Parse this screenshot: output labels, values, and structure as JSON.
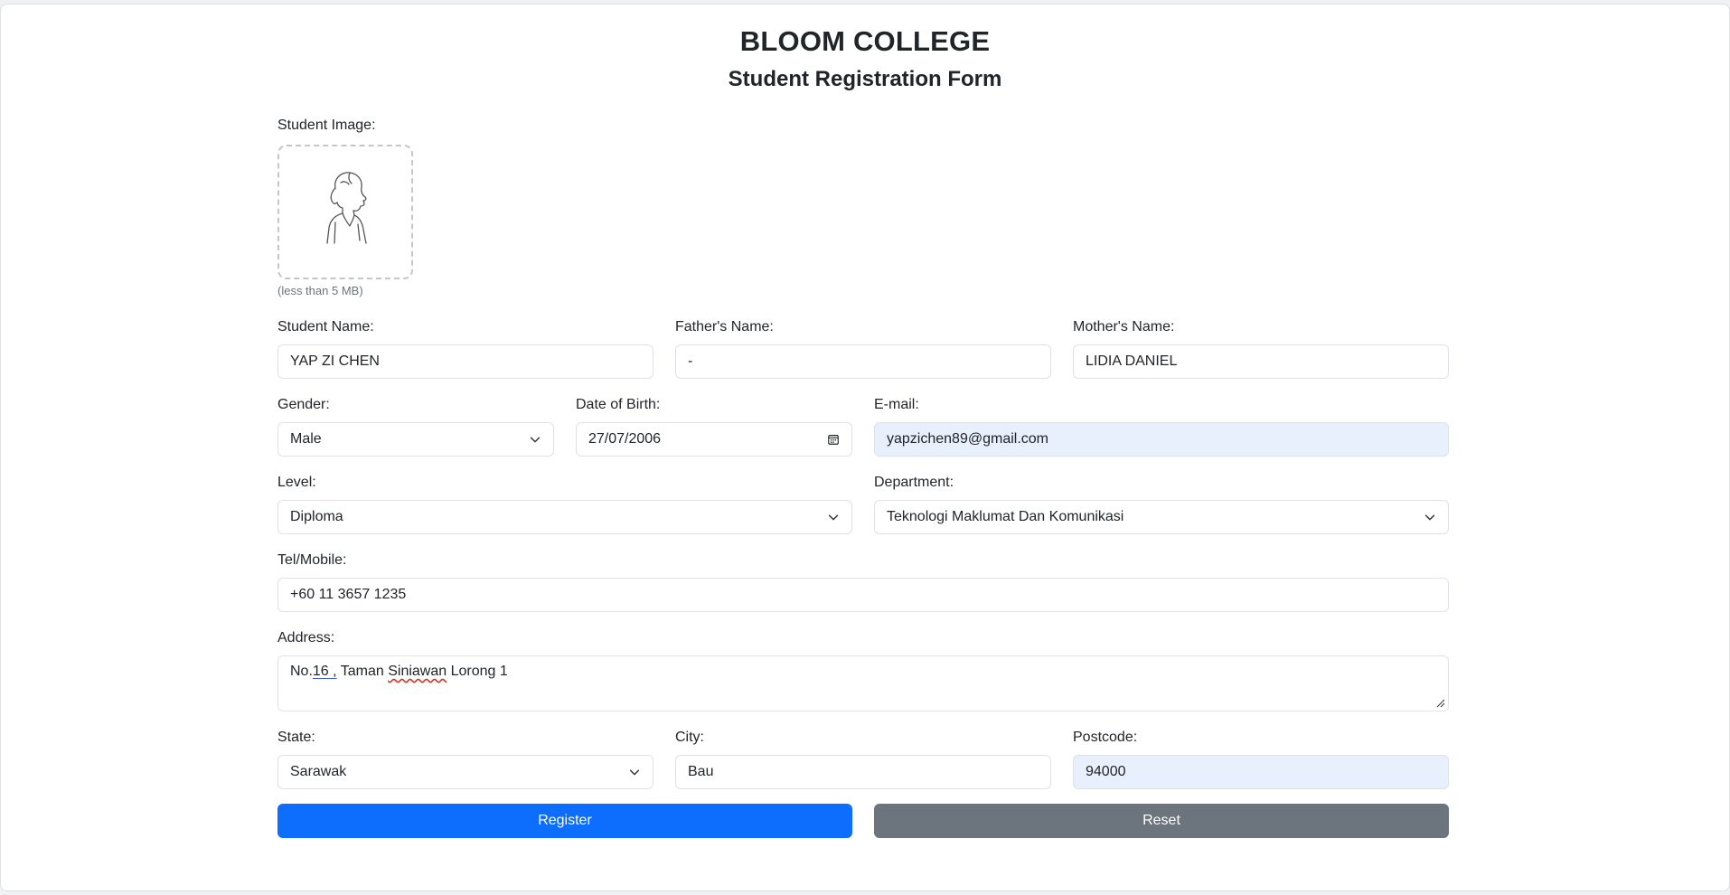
{
  "header": {
    "college": "BLOOM COLLEGE",
    "form_title": "Student Registration Form"
  },
  "image_upload": {
    "label": "Student Image:",
    "help": "(less than 5 MB)",
    "icon": "student-portrait-icon"
  },
  "fields": {
    "student_name": {
      "label": "Student Name:",
      "value": "YAP ZI CHEN"
    },
    "father_name": {
      "label": "Father's Name:",
      "value": "-"
    },
    "mother_name": {
      "label": "Mother's Name:",
      "value": "LIDIA DANIEL"
    },
    "gender": {
      "label": "Gender:",
      "value": "Male"
    },
    "dob": {
      "label": "Date of Birth:",
      "value": "27/07/2006"
    },
    "email": {
      "label": "E-mail:",
      "value": "yapzichen89@gmail.com"
    },
    "level": {
      "label": "Level:",
      "value": "Diploma"
    },
    "department": {
      "label": "Department:",
      "value": "Teknologi Maklumat Dan Komunikasi"
    },
    "tel": {
      "label": "Tel/Mobile:",
      "value": "+60 11 3657 1235"
    },
    "address": {
      "label": "Address:",
      "value_parts": [
        "No.",
        "16 ,",
        " Taman ",
        "Siniawan",
        " Lorong 1"
      ]
    },
    "state": {
      "label": "State:",
      "value": "Sarawak"
    },
    "city": {
      "label": "City:",
      "value": "Bau"
    },
    "postcode": {
      "label": "Postcode:",
      "value": "94000"
    }
  },
  "buttons": {
    "register": "Register",
    "reset": "Reset"
  },
  "colors": {
    "primary": "#0d6efd",
    "secondary": "#6c757d",
    "autofill": "#e8f0fe"
  }
}
